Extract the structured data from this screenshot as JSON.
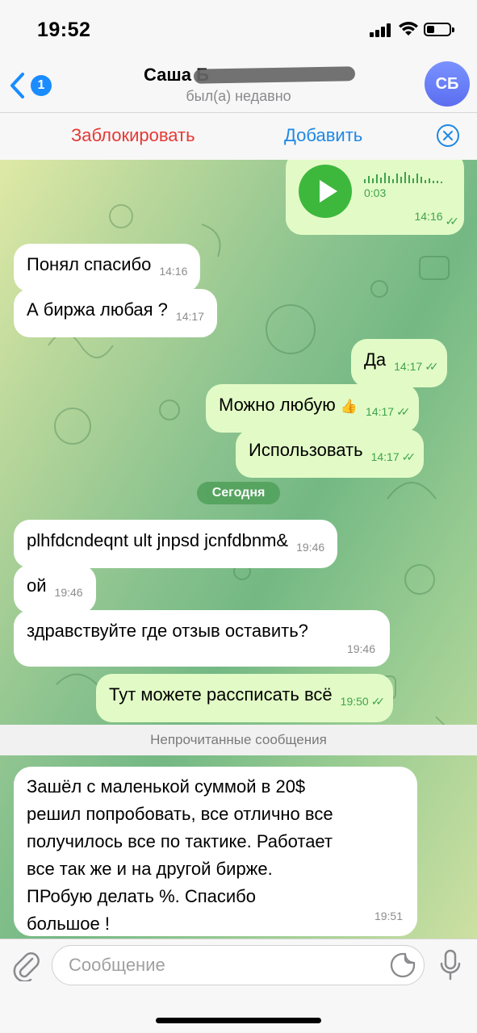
{
  "status_bar": {
    "time": "19:52"
  },
  "header": {
    "back_badge": "1",
    "contact_name": "Саша Б",
    "contact_status": "был(а) недавно",
    "avatar_initials": "СБ"
  },
  "actions": {
    "block_label": "Заблокировать",
    "add_label": "Добавить"
  },
  "voice_message": {
    "duration": "0:03",
    "time": "14:16"
  },
  "messages": [
    {
      "dir": "in",
      "text": "Понял спасибо",
      "time": "14:16"
    },
    {
      "dir": "in",
      "text": "А биржа любая ?",
      "time": "14:17"
    },
    {
      "dir": "out",
      "text": "Да",
      "time": "14:17"
    },
    {
      "dir": "out",
      "text": "Можно любую",
      "emoji": "👍",
      "time": "14:17"
    },
    {
      "dir": "out",
      "text": "Использовать",
      "time": "14:17"
    },
    {
      "dir": "in",
      "text": "plhfdcndeqnt ult jnpsd jcnfdbnm&",
      "time": "19:46"
    },
    {
      "dir": "in",
      "text": "ой",
      "time": "19:46"
    },
    {
      "dir": "in",
      "text": "здравствуйте где отзыв оставить?",
      "time": "19:46"
    },
    {
      "dir": "out",
      "text": "Тут можете рассписать всё",
      "time": "19:50"
    }
  ],
  "date_separator": "Сегодня",
  "unread_label": "Непрочитанные сообщения",
  "last_message": {
    "lines": [
      "Зашёл с маленькой суммой в 20$",
      "решил попробовать, все отлично все",
      "получилось все по тактике. Работает",
      "все так же и на другой бирже.",
      "ПРобую делать %. Спасибо",
      "большое !"
    ],
    "time": "19:51"
  },
  "input": {
    "placeholder": "Сообщение"
  },
  "colors": {
    "incoming_bubble": "#ffffff",
    "outgoing_bubble": "#e2fbc6",
    "accent_green": "#3fa34d",
    "block_red": "#e53935",
    "link_blue": "#1e88e5",
    "avatar": "#6b80f7"
  },
  "icons": [
    "chevron-left-icon",
    "x-circle-icon",
    "play-icon",
    "paperclip-icon",
    "sticker-icon",
    "microphone-icon",
    "double-check-icon"
  ]
}
